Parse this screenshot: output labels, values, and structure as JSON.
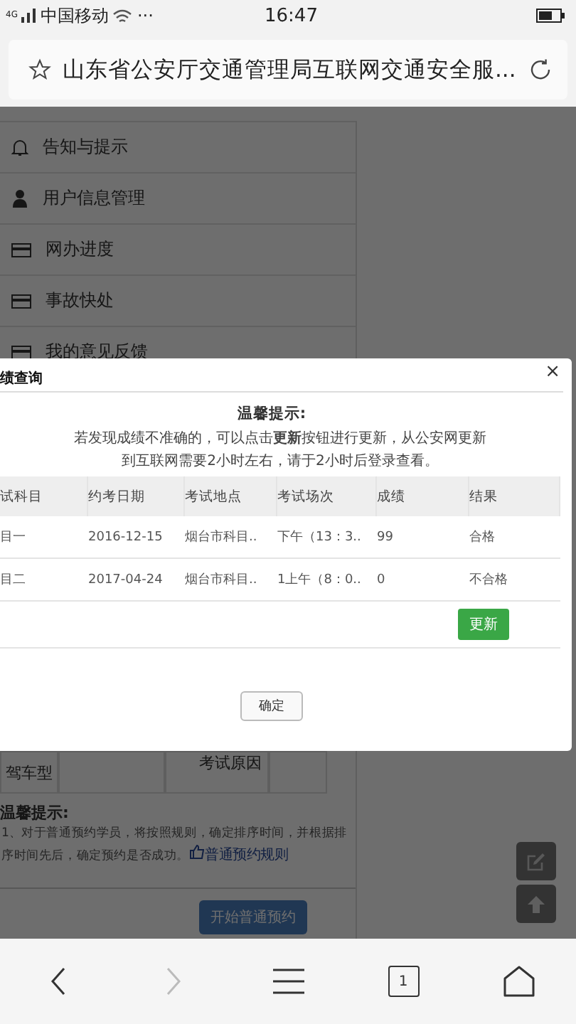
{
  "status_bar": {
    "signal": "4G",
    "carrier": "中国移动",
    "more": "···",
    "time": "16:47"
  },
  "address_bar": {
    "title": "山东省公安厅交通管理局互联网交通安全服..."
  },
  "sidebar": {
    "items": [
      {
        "label": "告知与提示",
        "kind": "bell"
      },
      {
        "label": "用户信息管理",
        "kind": "user"
      },
      {
        "label": "网办进度",
        "kind": "card"
      },
      {
        "label": "事故快处",
        "kind": "card"
      },
      {
        "label": "我的意见反馈",
        "kind": "card"
      }
    ]
  },
  "background": {
    "table_cells": [
      "驾车型",
      "考试原因"
    ],
    "notice_title": "温馨提示:",
    "notice_text": "1、对于普通预约学员，将按照规则，确定排序时间，并根据排序时间先后，确定预约是否成功。",
    "link": "普通预约规则",
    "button": "开始普通预约"
  },
  "dialog": {
    "title": "绩查询",
    "close": "×",
    "notice_title": "温馨提示:",
    "notice": "若发现成绩不准确的，可以点击**更新**按钮进行更新，从公安网更新到互联网需要2小时左右，请于2小时后登录查看。",
    "columns": [
      "试科目",
      "约考日期",
      "考试地点",
      "考试场次",
      "成绩",
      "结果"
    ],
    "rows": [
      [
        "目一",
        "2016-12-15",
        "烟台市科目..",
        "下午（13：3..",
        "99",
        "合格"
      ],
      [
        "目二",
        "2017-04-24",
        "烟台市科目..",
        "1上午（8：0..",
        "0",
        "不合格"
      ]
    ],
    "update_button": "更新",
    "ok_button": "确定"
  },
  "bottom_nav": [
    {
      "kind": "back",
      "disabled": false
    },
    {
      "kind": "forward",
      "disabled": true
    },
    {
      "kind": "menu",
      "disabled": false
    },
    {
      "kind": "tabs",
      "label": "1",
      "disabled": false
    },
    {
      "kind": "home",
      "disabled": false
    }
  ]
}
